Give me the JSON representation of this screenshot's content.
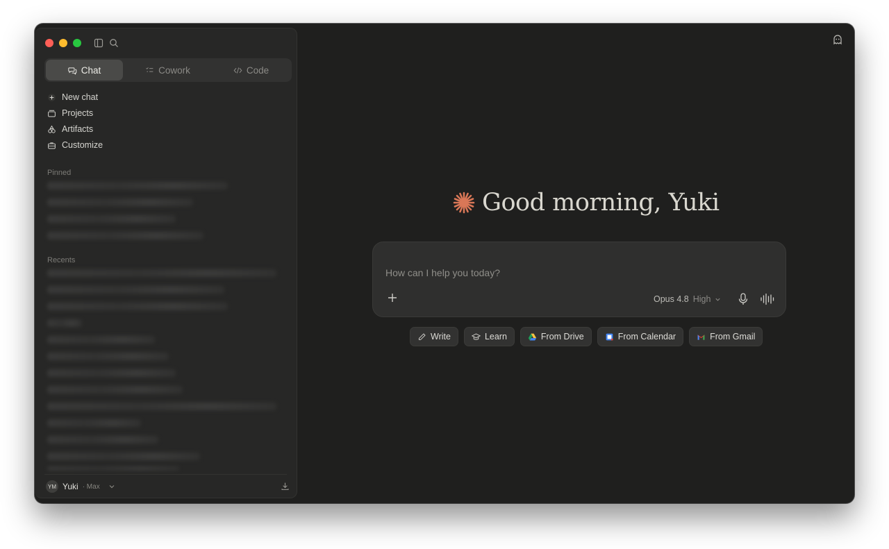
{
  "window": {
    "traffic_lights": {
      "close": "#ff5f57",
      "minimize": "#febc2e",
      "zoom": "#28c840"
    },
    "toolbar_icons": [
      "sidebar-toggle-icon",
      "search-icon"
    ]
  },
  "sidebar": {
    "modes": [
      {
        "label": "Chat",
        "icon": "chat-bubbles-icon",
        "active": true
      },
      {
        "label": "Cowork",
        "icon": "checklist-icon",
        "active": false
      },
      {
        "label": "Code",
        "icon": "code-icon",
        "active": false
      }
    ],
    "nav": [
      {
        "label": "New chat",
        "icon": "plus-icon"
      },
      {
        "label": "Projects",
        "icon": "folder-stack-icon"
      },
      {
        "label": "Artifacts",
        "icon": "shapes-icon"
      },
      {
        "label": "Customize",
        "icon": "briefcase-icon"
      }
    ],
    "pinned_label": "Pinned",
    "recents_label": "Recents",
    "user": {
      "initials": "YM",
      "name": "Yuki",
      "plan": "· Max"
    }
  },
  "main": {
    "greeting": "Good morning, Yuki",
    "accent_color": "#d97757",
    "composer": {
      "placeholder": "How can I help you today?",
      "model": "Opus 4.8",
      "effort": "High"
    },
    "chips": [
      {
        "label": "Write",
        "icon": "pencil-icon"
      },
      {
        "label": "Learn",
        "icon": "graduation-cap-icon"
      },
      {
        "label": "From Drive",
        "icon": "google-drive-icon"
      },
      {
        "label": "From Calendar",
        "icon": "google-calendar-icon"
      },
      {
        "label": "From Gmail",
        "icon": "gmail-icon"
      }
    ],
    "top_right_icon": "ghost-icon"
  }
}
